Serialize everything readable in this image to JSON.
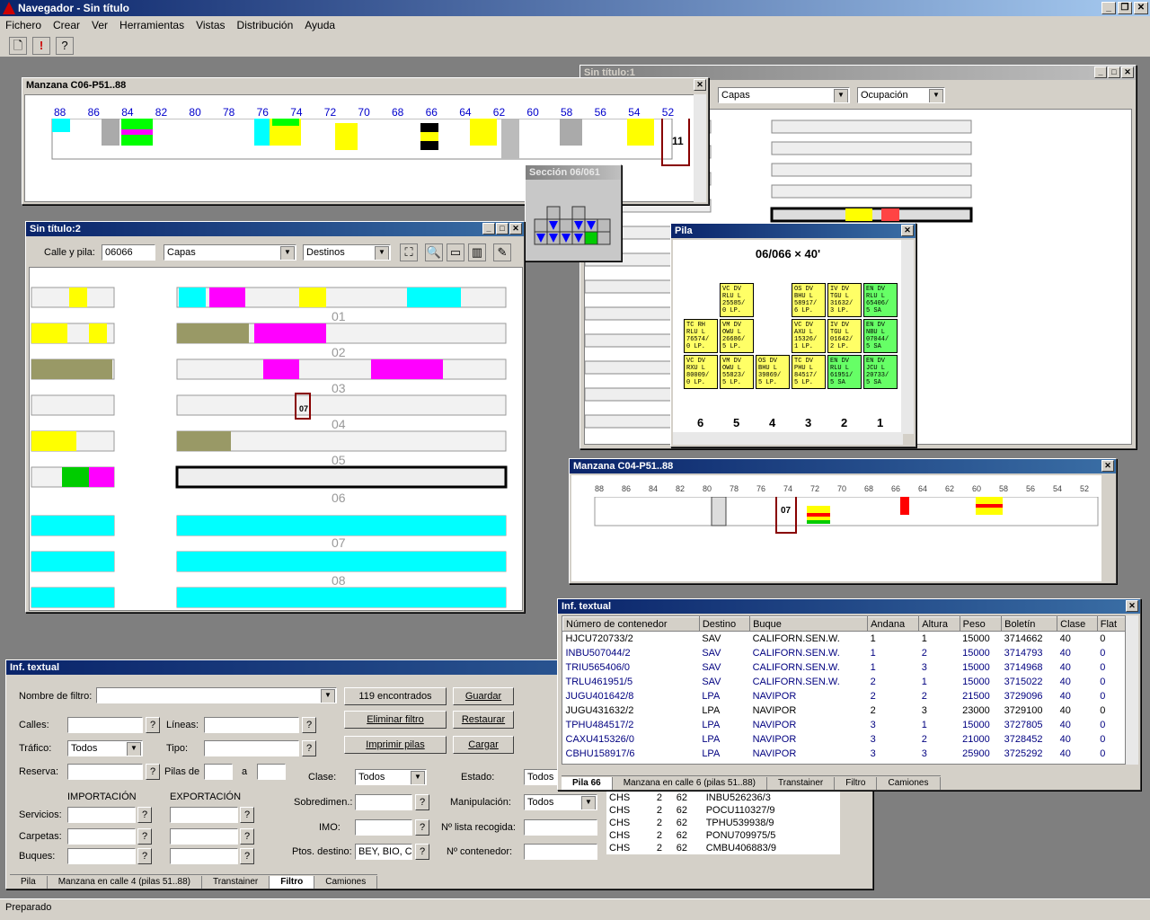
{
  "app": {
    "title": "Navegador - Sin título"
  },
  "menu": [
    "Fichero",
    "Crear",
    "Ver",
    "Herramientas",
    "Vistas",
    "Distribución",
    "Ayuda"
  ],
  "status": "Preparado",
  "win_c06": {
    "title": "Manzana C06-P51..88",
    "cols": [
      "88",
      "86",
      "84",
      "82",
      "80",
      "78",
      "76",
      "74",
      "72",
      "70",
      "68",
      "66",
      "64",
      "62",
      "60",
      "58",
      "56",
      "54",
      "52"
    ],
    "marker": "11"
  },
  "win_seccion": {
    "title": "Sección 06/061"
  },
  "win_sin1": {
    "title": "Sin título:1",
    "combo1": "Capas",
    "combo2": "Ocupación"
  },
  "win_sin2": {
    "title": "Sin título:2",
    "calle_label": "Calle y pila:",
    "calle_value": "06066",
    "combo1": "Capas",
    "combo2": "Destinos",
    "labels": [
      "01",
      "02",
      "03",
      "04",
      "05",
      "06",
      "07",
      "08"
    ],
    "marker": "07"
  },
  "win_pila": {
    "title": "Pila",
    "heading": "06/066 × 40'",
    "cols": [
      "6",
      "5",
      "4",
      "3",
      "2",
      "1"
    ],
    "stacks": [
      {
        "t": "VC DV RLU L 25585/ 0 LP.",
        "c": 5,
        "r": 3,
        "bg": "#ffff66"
      },
      {
        "t": "OS DV BHU L 58917/ 6 LP.",
        "c": 3,
        "r": 3,
        "bg": "#ffff66"
      },
      {
        "t": "IV DV TGU L 31632/ 3 LP.",
        "c": 2,
        "r": 3,
        "bg": "#ffff66"
      },
      {
        "t": "EN DV RLU L 65406/ 5 SA",
        "c": 1,
        "r": 3,
        "bg": "#66ff66"
      },
      {
        "t": "TC RH RLU L 76574/ 0 LP.",
        "c": 6,
        "r": 2,
        "bg": "#ffff66"
      },
      {
        "t": "VM DV OWU L 26686/ 5 LP.",
        "c": 5,
        "r": 2,
        "bg": "#ffff66"
      },
      {
        "t": "VC DV AXU L 15326/ 1 LP.",
        "c": 3,
        "r": 2,
        "bg": "#ffff66"
      },
      {
        "t": "IV DV TGU L 01642/ 2 LP.",
        "c": 2,
        "r": 2,
        "bg": "#ffff66"
      },
      {
        "t": "EN DV NBU L 07044/ 5 SA",
        "c": 1,
        "r": 2,
        "bg": "#66ff66"
      },
      {
        "t": "VC DV RXU L 80009/ 0 LP.",
        "c": 6,
        "r": 1,
        "bg": "#ffff66"
      },
      {
        "t": "VM DV OWU L 55823/ 5 LP.",
        "c": 5,
        "r": 1,
        "bg": "#ffff66"
      },
      {
        "t": "OS DV BHU L 39869/ 5 LP.",
        "c": 4,
        "r": 1,
        "bg": "#ffff66"
      },
      {
        "t": "TC DV PHU L 84517/ 5 LP.",
        "c": 3,
        "r": 1,
        "bg": "#ffff66"
      },
      {
        "t": "EN DV RLU L 61951/ 5 SA",
        "c": 2,
        "r": 1,
        "bg": "#66ff66"
      },
      {
        "t": "EN DV JCU L 20733/ 5 SA",
        "c": 1,
        "r": 1,
        "bg": "#66ff66"
      }
    ]
  },
  "win_c04": {
    "title": "Manzana C04-P51..88",
    "cols": [
      "88",
      "86",
      "84",
      "82",
      "80",
      "78",
      "76",
      "74",
      "72",
      "70",
      "68",
      "66",
      "64",
      "62",
      "60",
      "58",
      "56",
      "54",
      "52"
    ],
    "marker": "07"
  },
  "win_inf1": {
    "title": "Inf. textual",
    "headers": [
      "Número de contenedor",
      "Destino",
      "Buque",
      "Andana",
      "Altura",
      "Peso",
      "Boletín",
      "Clase",
      "Flat"
    ],
    "rows": [
      [
        "HJCU720733/2",
        "SAV",
        "CALIFORN.SEN.W.",
        "1",
        "1",
        "15000",
        "3714662",
        "40",
        "0"
      ],
      [
        "INBU507044/2",
        "SAV",
        "CALIFORN.SEN.W.",
        "1",
        "2",
        "15000",
        "3714793",
        "40",
        "0"
      ],
      [
        "TRIU565406/0",
        "SAV",
        "CALIFORN.SEN.W.",
        "1",
        "3",
        "15000",
        "3714968",
        "40",
        "0"
      ],
      [
        "TRLU461951/5",
        "SAV",
        "CALIFORN.SEN.W.",
        "2",
        "1",
        "15000",
        "3715022",
        "40",
        "0"
      ],
      [
        "JUGU401642/8",
        "LPA",
        "NAVIPOR",
        "2",
        "2",
        "21500",
        "3729096",
        "40",
        "0"
      ],
      [
        "JUGU431632/2",
        "LPA",
        "NAVIPOR",
        "2",
        "3",
        "23000",
        "3729100",
        "40",
        "0"
      ],
      [
        "TPHU484517/2",
        "LPA",
        "NAVIPOR",
        "3",
        "1",
        "15000",
        "3727805",
        "40",
        "0"
      ],
      [
        "CAXU415326/0",
        "LPA",
        "NAVIPOR",
        "3",
        "2",
        "21000",
        "3728452",
        "40",
        "0"
      ],
      [
        "CBHU158917/6",
        "LPA",
        "NAVIPOR",
        "3",
        "3",
        "25900",
        "3725292",
        "40",
        "0"
      ]
    ],
    "tabs": [
      "Pila 66",
      "Manzana en calle 6 (pilas 51..88)",
      "Transtainer",
      "Filtro",
      "Camiones"
    ]
  },
  "win_inf2": {
    "title": "Inf. textual",
    "nombre_filtro": "Nombre de filtro:",
    "found": "119 encontrados",
    "buttons": {
      "guardar": "Guardar",
      "eliminar": "Eliminar filtro",
      "restaurar": "Restaurar",
      "imprimir": "Imprimir pilas",
      "cargar": "Cargar"
    },
    "labels": {
      "calles": "Calles:",
      "lineas": "Líneas:",
      "trafico": "Tráfico:",
      "tipo": "Tipo:",
      "reserva": "Reserva:",
      "pilas_de": "Pilas de",
      "a": "a",
      "clase": "Clase:",
      "estado": "Estado:",
      "importacion": "IMPORTACIÓN",
      "exportacion": "EXPORTACIÓN",
      "sobredimen": "Sobredimen.:",
      "manipulacion": "Manipulación:",
      "servicios": "Servicios:",
      "carpetas": "Carpetas:",
      "buques": "Buques:",
      "imo": "IMO:",
      "lista": "Nº lista recogida:",
      "ptos": "Ptos. destino:",
      "ncont": "Nº contenedor:"
    },
    "values": {
      "trafico": "Todos",
      "clase": "Todos",
      "estado": "Todos",
      "manipulacion": "Todos",
      "ptos": "BEY, BIO, C"
    },
    "rows2": [
      [
        "CHS",
        "2",
        "62",
        "INBU526236/3"
      ],
      [
        "CHS",
        "2",
        "62",
        "POCU110327/9"
      ],
      [
        "CHS",
        "2",
        "62",
        "TPHU539938/9"
      ],
      [
        "CHS",
        "2",
        "62",
        "PONU709975/5"
      ],
      [
        "CHS",
        "2",
        "62",
        "CMBU406883/9"
      ]
    ],
    "tabs": [
      "Pila",
      "Manzana en calle 4 (pilas 51..88)",
      "Transtainer",
      "Filtro",
      "Camiones"
    ]
  }
}
